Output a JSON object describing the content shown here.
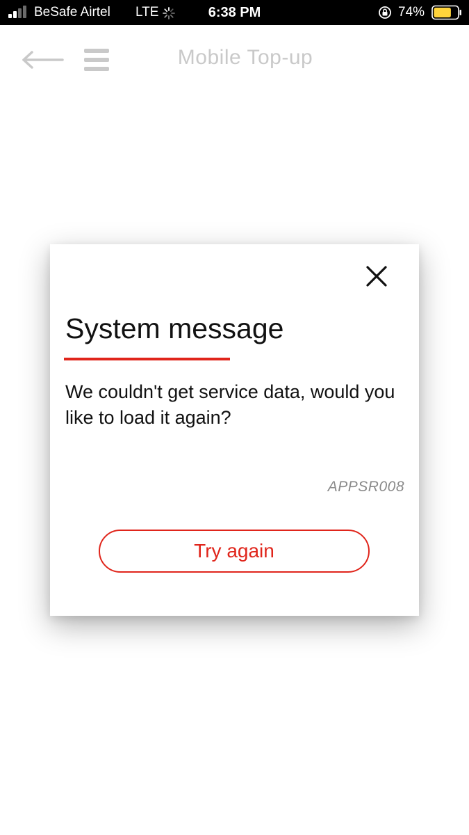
{
  "status_bar": {
    "carrier": "BeSafe Airtel",
    "network": "LTE",
    "time": "6:38 PM",
    "battery_percent": "74%",
    "battery_level": 0.74,
    "signal_bars_filled": 2,
    "signal_bars_total": 4,
    "icons": {
      "signal": "cellular-signal-icon",
      "activity": "loading-spinner-icon",
      "lock": "orientation-lock-icon",
      "battery": "battery-icon"
    }
  },
  "header": {
    "title": "Mobile Top-up",
    "back_icon": "back-arrow-icon",
    "menu_icon": "hamburger-menu-icon"
  },
  "dialog": {
    "title": "System message",
    "message": "We couldn't get service data, would you like to load it again?",
    "error_code": "APPSR008",
    "button_label": "Try again",
    "close_icon": "close-icon"
  },
  "colors": {
    "accent": "#e0251b",
    "header_muted": "#c9c9c9",
    "battery_fill": "#ffd43b",
    "status_bar_bg": "#000000",
    "text_dark": "#111111"
  }
}
